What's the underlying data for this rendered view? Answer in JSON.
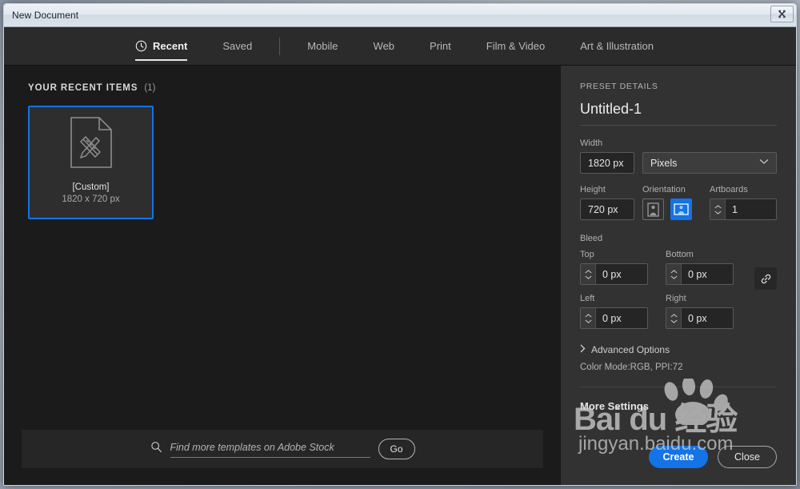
{
  "window": {
    "title": "New Document",
    "close_button_label": "✖",
    "close_button_icon": "close-x-icon"
  },
  "tabs": [
    {
      "id": "recent",
      "label": "Recent",
      "icon": "clock-icon",
      "active": true
    },
    {
      "id": "saved",
      "label": "Saved",
      "icon": null,
      "active": false
    },
    {
      "id": "mobile",
      "label": "Mobile",
      "icon": null,
      "active": false
    },
    {
      "id": "web",
      "label": "Web",
      "icon": null,
      "active": false
    },
    {
      "id": "print",
      "label": "Print",
      "icon": null,
      "active": false
    },
    {
      "id": "film-video",
      "label": "Film & Video",
      "icon": null,
      "active": false
    },
    {
      "id": "art-illustration",
      "label": "Art & Illustration",
      "icon": null,
      "active": false
    }
  ],
  "recent": {
    "heading": "YOUR RECENT ITEMS",
    "count": "(1)",
    "items": [
      {
        "name": "[Custom]",
        "dimensions": "1820 x 720 px",
        "icon": "document-pencil-ruler-icon",
        "selected": true
      }
    ]
  },
  "stock_search": {
    "icon": "search-icon",
    "placeholder": "Find more templates on Adobe Stock",
    "value": "",
    "go_label": "Go"
  },
  "preset": {
    "section_label": "PRESET DETAILS",
    "document_name": "Untitled-1",
    "width": {
      "label": "Width",
      "value": "1820 px"
    },
    "units": {
      "value": "Pixels",
      "chevron": "chevron-down-icon"
    },
    "height": {
      "label": "Height",
      "value": "720 px"
    },
    "orientation": {
      "label": "Orientation",
      "portrait_icon": "orientation-portrait-icon",
      "landscape_icon": "orientation-landscape-icon",
      "selected": "landscape"
    },
    "artboards": {
      "label": "Artboards",
      "value": "1"
    },
    "bleed": {
      "label": "Bleed",
      "top": {
        "label": "Top",
        "value": "0 px"
      },
      "bottom": {
        "label": "Bottom",
        "value": "0 px"
      },
      "left": {
        "label": "Left",
        "value": "0 px"
      },
      "right": {
        "label": "Right",
        "value": "0 px"
      },
      "link_icon": "link-chain-icon"
    },
    "advanced_options": {
      "label": "Advanced Options",
      "chevron": "chevron-right-icon"
    },
    "color_mode_summary": "Color Mode:RGB, PPI:72",
    "more_settings": "More Settings"
  },
  "actions": {
    "create_label": "Create",
    "close_label": "Close"
  },
  "watermark": {
    "brand": "Bai  du 经验",
    "url": "jingyan.baidu.com"
  },
  "colors": {
    "accent": "#1473e6",
    "panel_dark": "#1b1b1b",
    "panel_light": "#323232",
    "tabbar": "#2b2b2b"
  }
}
